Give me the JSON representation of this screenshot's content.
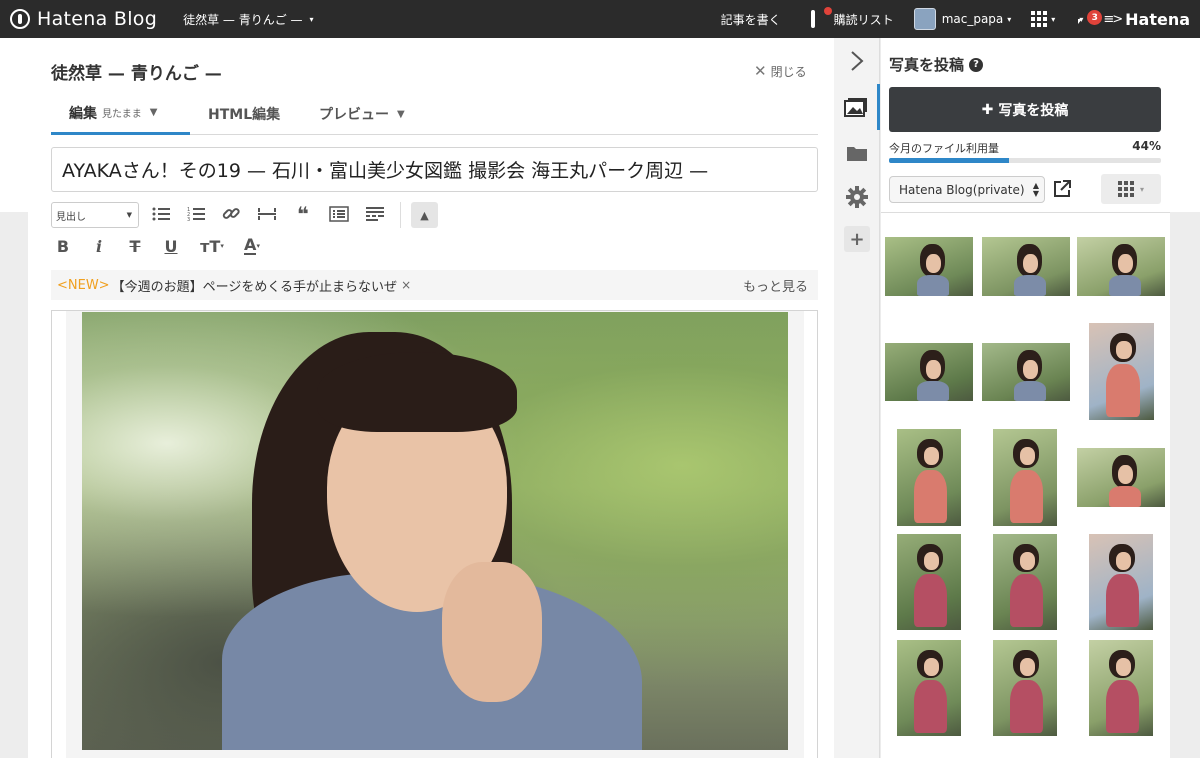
{
  "topbar": {
    "brand": "Hatena Blog",
    "blog_name": "徒然草 — 青りんご —",
    "write_label": "記事を書く",
    "reading_list_label": "購読リスト",
    "username": "mac_papa",
    "notification_count": "3",
    "hatena_label": "Hatena"
  },
  "editor": {
    "title": "徒然草 — 青りんご —",
    "close_label": "閉じる",
    "tabs": [
      {
        "label": "編集",
        "sub": "見たまま"
      },
      {
        "label": "HTML編集"
      },
      {
        "label": "プレビュー"
      }
    ],
    "entry_title": "AYAKAさん！その19 — 石川・富山美少女図鑑 撮影会 海王丸パーク周辺 —",
    "format_select": "見出し",
    "notice": {
      "new_tag": "<NEW>",
      "text": "【今週のお題】ページをめくる手が止まらないぜ",
      "close": "×",
      "more": "もっと見る"
    }
  },
  "photo_panel": {
    "title": "写真を投稿",
    "post_button": "写真を投稿",
    "usage_label": "今月のファイル利用量",
    "usage_percent": "44%",
    "usage_value": 0.44,
    "blog_select": "Hatena Blog(private)"
  },
  "colors": {
    "accent": "#2e87c8",
    "topbar": "#2b2b2b",
    "notice_new": "#f0a020",
    "badge": "#e0433a"
  },
  "icons": [
    "chevron-right-icon",
    "photo-icon",
    "folder-icon",
    "gear-icon",
    "plus-icon",
    "help-icon",
    "external-link-icon",
    "grid-icon",
    "close-icon",
    "chevron-down-icon"
  ]
}
